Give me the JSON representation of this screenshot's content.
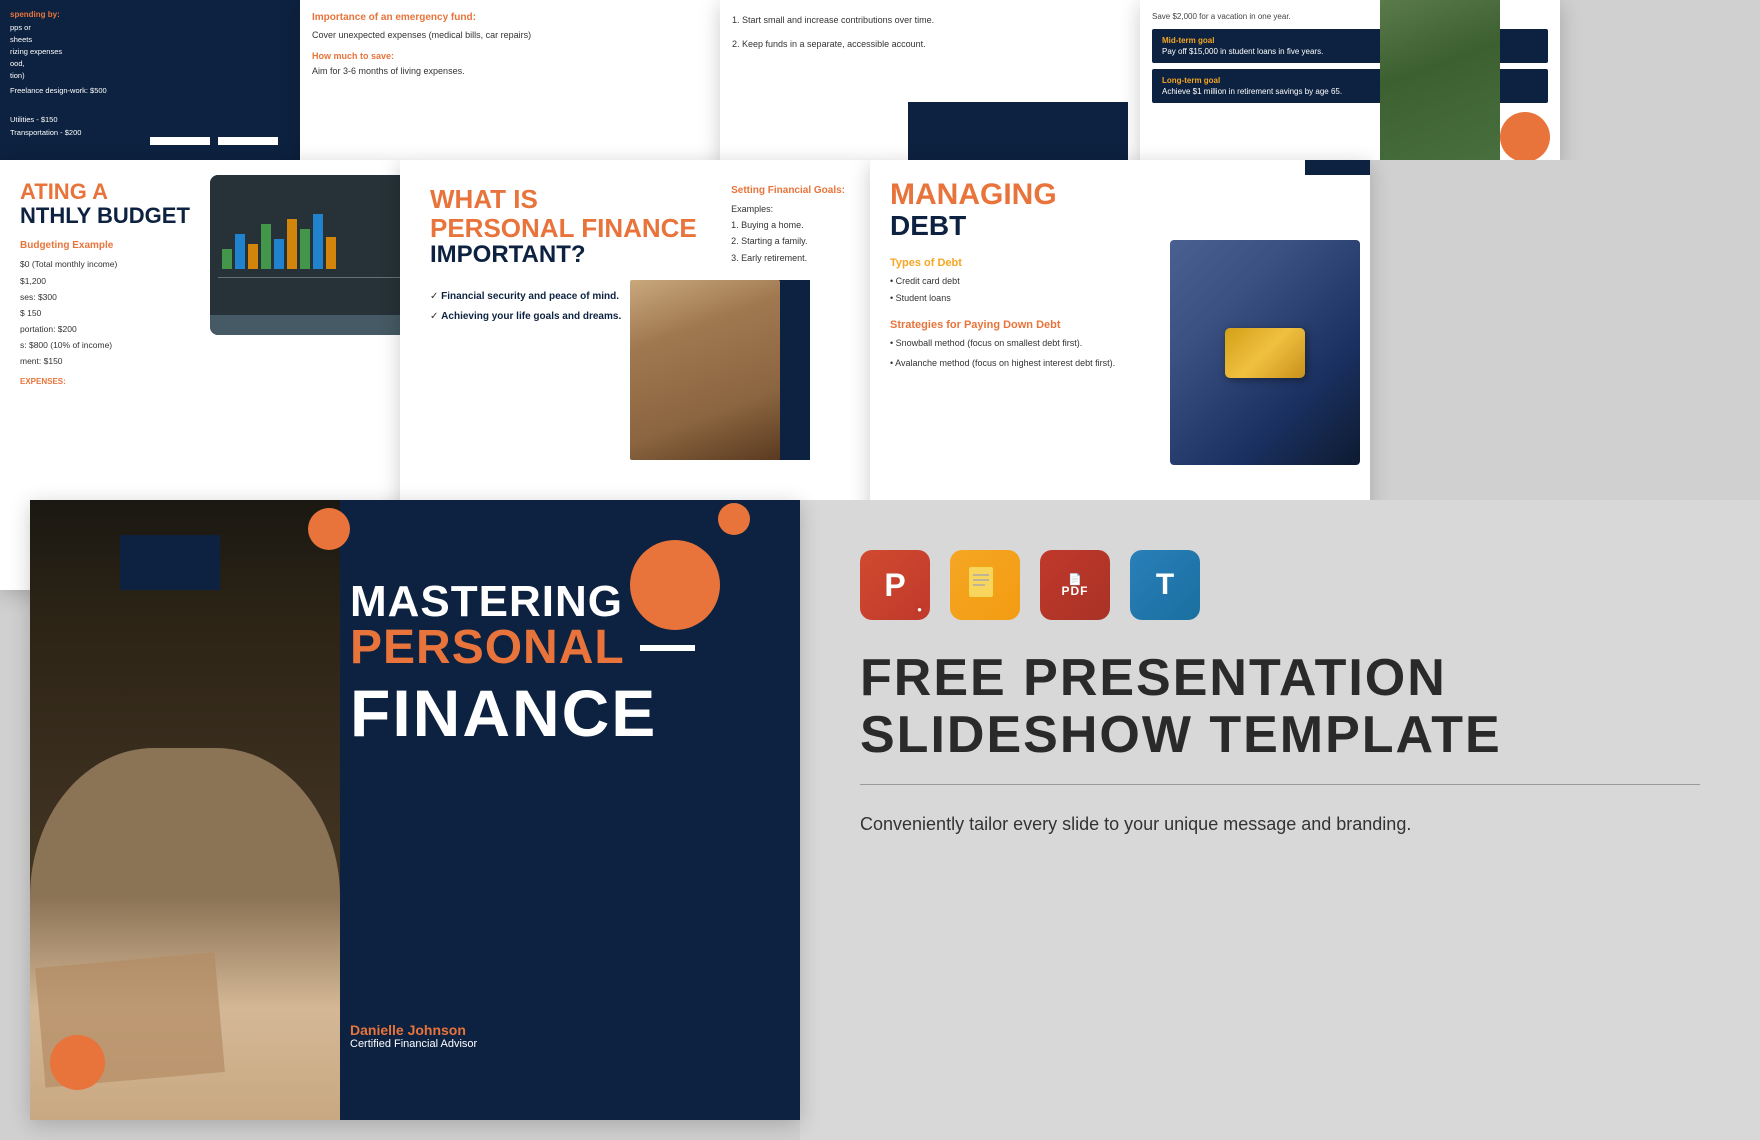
{
  "page": {
    "background_color": "#d0d0d0",
    "title": "Free Presentation Slideshow Template"
  },
  "top_row": {
    "slide1_dark": {
      "label": "spending by:",
      "items": [
        "pps or",
        "sheets",
        "rizing expenses",
        "ood,",
        "tion)"
      ],
      "item2": "Freelance design-work: $500",
      "item3": "Utilities - $150",
      "item4": "Transportation - $200"
    },
    "slide2_emergency": {
      "title": "Importance of an emergency fund:",
      "body1": "Cover unexpected expenses (medical bills, car repairs)",
      "how_much_title": "How much to save:",
      "body2": "Aim for 3-6 months of living expenses."
    },
    "slide3_steps": {
      "items": [
        "1. Start small and increase contributions over time.",
        "2. Keep funds in a separate, accessible account."
      ]
    },
    "slide4_goals": {
      "save_text": "Save $2,000 for a vacation in one year.",
      "mid_term_label": "Mid-term goal",
      "mid_term_text": "Pay off $15,000 in student loans in five years.",
      "long_term_label": "Long-term goal",
      "long_term_text": "Achieve $1 million in retirement savings by age 65."
    }
  },
  "middle_row": {
    "slide1_budget": {
      "title_orange": "ATING A",
      "title_dark": "NTHLY BUDGET",
      "subtitle_orange": "Budgeting Example",
      "income": "$0 (Total monthly income)",
      "expenses": [
        "$1,200",
        "ses: $300",
        "$ 150",
        "portation: $200",
        "s: $800 (10% of income)",
        "ment: $150"
      ],
      "expenses_label": "EXPENSES:"
    },
    "slide2_personal_finance": {
      "title_orange": "WHAT IS",
      "title_orange2": "PERSONAL FINANCE",
      "title_dark": "IMPORTANT?",
      "check1": "Financial security and peace of mind.",
      "check2": "Achieving your life goals and dreams.",
      "setting_label": "Setting Financial Goals:",
      "examples_intro": "Examples:",
      "examples": [
        "1. Buying a home.",
        "2. Starting a family.",
        "3. Early retirement."
      ]
    },
    "slide3_debt": {
      "title_orange": "MANAGING",
      "title_dark": "DEBT",
      "types_label": "Types of Debt",
      "types": [
        "Credit card debt",
        "Student loans"
      ],
      "strategies_label": "Strategies for Paying Down Debt",
      "strategies": [
        "Snowball method (focus on smallest debt first).",
        "Avalanche method (focus on highest interest debt first)."
      ]
    }
  },
  "hero": {
    "mastering": "MASTERING",
    "personal": "PERSONAL",
    "finance": "FINANCE",
    "author_name": "Danielle Johnson",
    "author_title": "Certified Financial Advisor"
  },
  "promo": {
    "icons": [
      {
        "label": "P",
        "type": "powerpoint",
        "sublabel": ""
      },
      {
        "label": "G",
        "type": "google-slides",
        "sublabel": ""
      },
      {
        "label": "PDF",
        "type": "pdf",
        "sublabel": "PDF"
      },
      {
        "label": "T",
        "type": "other",
        "sublabel": ""
      }
    ],
    "title_line1": "FREE PRESENTATION",
    "title_line2": "SLIDESHOW TEMPLATE",
    "description": "Conveniently tailor every slide to your unique message and branding."
  }
}
